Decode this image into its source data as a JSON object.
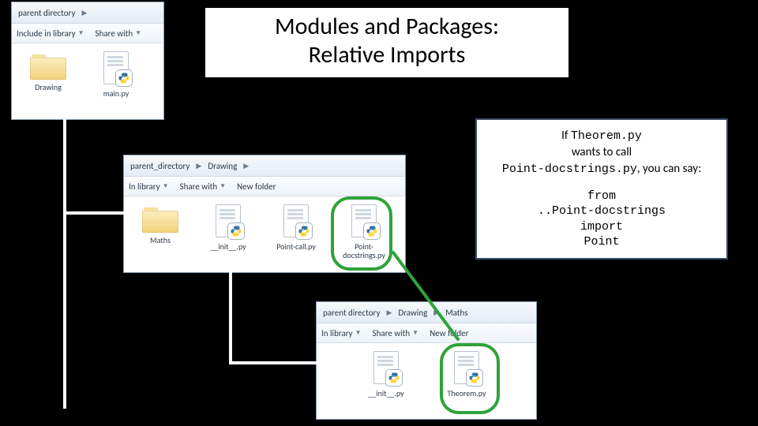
{
  "title": "Modules and Packages:\nRelative Imports",
  "win1": {
    "addr": {
      "crumb1": "parent directory"
    },
    "toolbar": {
      "include": "Include in library",
      "share": "Share with",
      "new": ""
    },
    "items": {
      "a": "Drawing",
      "b": "main.py"
    }
  },
  "win2": {
    "addr": {
      "crumb1": "parent_directory",
      "crumb2": "Drawing"
    },
    "toolbar": {
      "include": "In library",
      "share": "Share with",
      "new": "New folder"
    },
    "items": {
      "a": "Maths",
      "b": "__init__.py",
      "c": "Point-call.py",
      "d": "Point-docstrings.py"
    }
  },
  "win3": {
    "addr": {
      "crumb1": "parent directory",
      "crumb2": "Drawing",
      "crumb3": "Maths"
    },
    "toolbar": {
      "include": "In library",
      "share": "Share with",
      "new": "New folder"
    },
    "items": {
      "a": "__init__.py",
      "b": "Theorem.py"
    }
  },
  "callout": {
    "pre": "If ",
    "c1": "Theorem.py",
    "mid1": " wants to call ",
    "c2": "Point-docstrings.py",
    "mid2": ", you can say:",
    "line1": "from",
    "line2": "..Point-docstrings",
    "line3": "import",
    "line4": "Point"
  }
}
